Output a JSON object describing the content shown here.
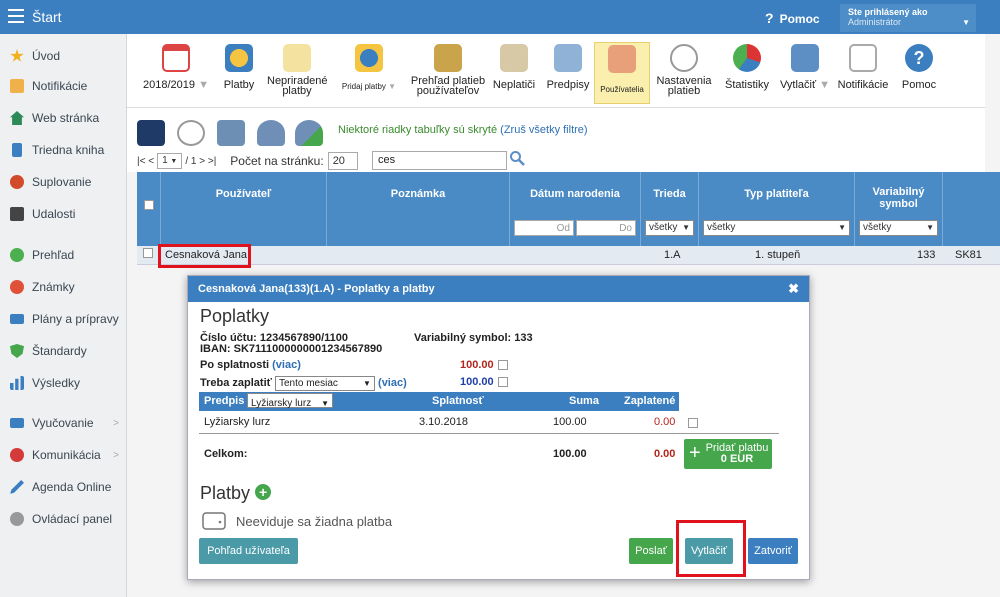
{
  "topbar": {
    "title": "Štart",
    "help": "Pomoc",
    "user_line1": "Ste prihlásený ako",
    "user_line2": "Administrátor"
  },
  "sidebar": {
    "items": [
      {
        "label": "Úvod",
        "icon": "star-icon",
        "color": "#f2b01e"
      },
      {
        "label": "Notifikácie",
        "icon": "envelope-icon",
        "color": "#f0b04a"
      },
      {
        "label": "Web stránka",
        "icon": "home-icon",
        "color": "#2c8a59"
      },
      {
        "label": "Triedna kniha",
        "icon": "book-icon",
        "color": "#3b7fc0"
      },
      {
        "label": "Suplovanie",
        "icon": "substitute-icon",
        "color": "#d14b2a"
      },
      {
        "label": "Udalosti",
        "icon": "calendar-icon",
        "color": "#444"
      },
      {
        "label": "Prehľad",
        "icon": "check-circle-icon",
        "color": "#4caf50"
      },
      {
        "label": "Známky",
        "icon": "grades-icon",
        "color": "#e0513a"
      },
      {
        "label": "Plány a prípravy",
        "icon": "briefcase-icon",
        "color": "#3b7fc0"
      },
      {
        "label": "Štandardy",
        "icon": "shield-check-icon",
        "color": "#45a64c"
      },
      {
        "label": "Výsledky",
        "icon": "bar-chart-icon",
        "color": "#3b7fc0"
      },
      {
        "label": "Vyučovanie",
        "icon": "teaching-icon",
        "color": "#3b7fc0"
      },
      {
        "label": "Komunikácia",
        "icon": "chat-icon",
        "color": "#d43a3a"
      },
      {
        "label": "Agenda Online",
        "icon": "pen-icon",
        "color": "#3b7fc0"
      },
      {
        "label": "Ovládací panel",
        "icon": "gear-icon",
        "color": "#999"
      }
    ]
  },
  "toolbar": {
    "items": [
      {
        "label": "2018/2019",
        "icon": "calendar-icon",
        "dropdown": true
      },
      {
        "label": "Platby",
        "icon": "coins-icon"
      },
      {
        "label": "Nepriradené platby",
        "icon": "unassigned-payments-icon"
      },
      {
        "label": "Pridaj platby",
        "icon": "add-payments-icon",
        "dropdown": true
      },
      {
        "label": "Prehľad platieb používateľov",
        "icon": "payments-overview-icon"
      },
      {
        "label": "Neplatiči",
        "icon": "debtors-icon"
      },
      {
        "label": "Predpisy",
        "icon": "prescriptions-icon"
      },
      {
        "label": "Používatelia",
        "icon": "users-icon"
      },
      {
        "label": "Nastavenia platieb",
        "icon": "payment-settings-icon"
      },
      {
        "label": "Štatistiky",
        "icon": "pie-chart-icon"
      },
      {
        "label": "Vytlačiť",
        "icon": "printer-icon",
        "dropdown": true
      },
      {
        "label": "Notifikácie",
        "icon": "notification-icon"
      },
      {
        "label": "Pomoc",
        "icon": "help-icon"
      }
    ]
  },
  "filters": {
    "note": "Niektoré riadky tabuľky sú skryté",
    "clear_link": "(Zruš všetky filtre)",
    "pager_first": "|< <",
    "pager_page": "1",
    "pager_of": "/ 1 > >|",
    "per_page_label": "Počet na stránku:",
    "per_page_value": "20",
    "search_value": "ces"
  },
  "table": {
    "headers": {
      "user": "Používateľ",
      "note": "Poznámka",
      "birth": "Dátum narodenia",
      "class": "Trieda",
      "payer_type": "Typ platiteľa",
      "varsym": "Variabilný symbol"
    },
    "filters": {
      "date_from": "Od",
      "date_to": "Do",
      "class": "všetky",
      "payer_type": "všetky",
      "varsym": "všetky"
    },
    "row": {
      "user": "Cesnaková Jana",
      "class": "1.A",
      "payer_type": "1. stupeň",
      "varsym": "133",
      "extra": "SK81"
    }
  },
  "modal": {
    "title": "Cesnaková Jana(133)(1.A) - Poplatky a platby",
    "fees_heading": "Poplatky",
    "account": "Číslo účtu: 1234567890/1100",
    "iban": "IBAN: SK7111000000001234567890",
    "varsym": "Variabilný symbol: 133",
    "overdue_label": "Po splatnosti",
    "overdue_link": "(viac)",
    "overdue_value": "100.00",
    "topay_label": "Treba zaplatiť",
    "topay_select": "Tento mesiac",
    "topay_link": "(viac)",
    "topay_value": "100.00",
    "fee_table": {
      "col_prescription": "Predpis",
      "prescription_select": "Lyžiarsky lurz",
      "col_due": "Splatnosť",
      "col_sum": "Suma",
      "col_paid": "Zaplatené",
      "row": {
        "name": "Lyžiarsky lurz",
        "due": "3.10.2018",
        "sum": "100.00",
        "paid": "0.00"
      },
      "total_label": "Celkom:",
      "total_sum": "100.00",
      "total_paid": "0.00"
    },
    "add_payment_label": "Pridať platbu",
    "add_payment_amount": "0 EUR",
    "payments_heading": "Platby",
    "no_payments": "Neeviduje sa žiadna platba",
    "user_view_button": "Pohľad užívateľa",
    "send_button": "Poslať",
    "print_button": "Vytlačiť",
    "close_button": "Zatvoriť"
  }
}
